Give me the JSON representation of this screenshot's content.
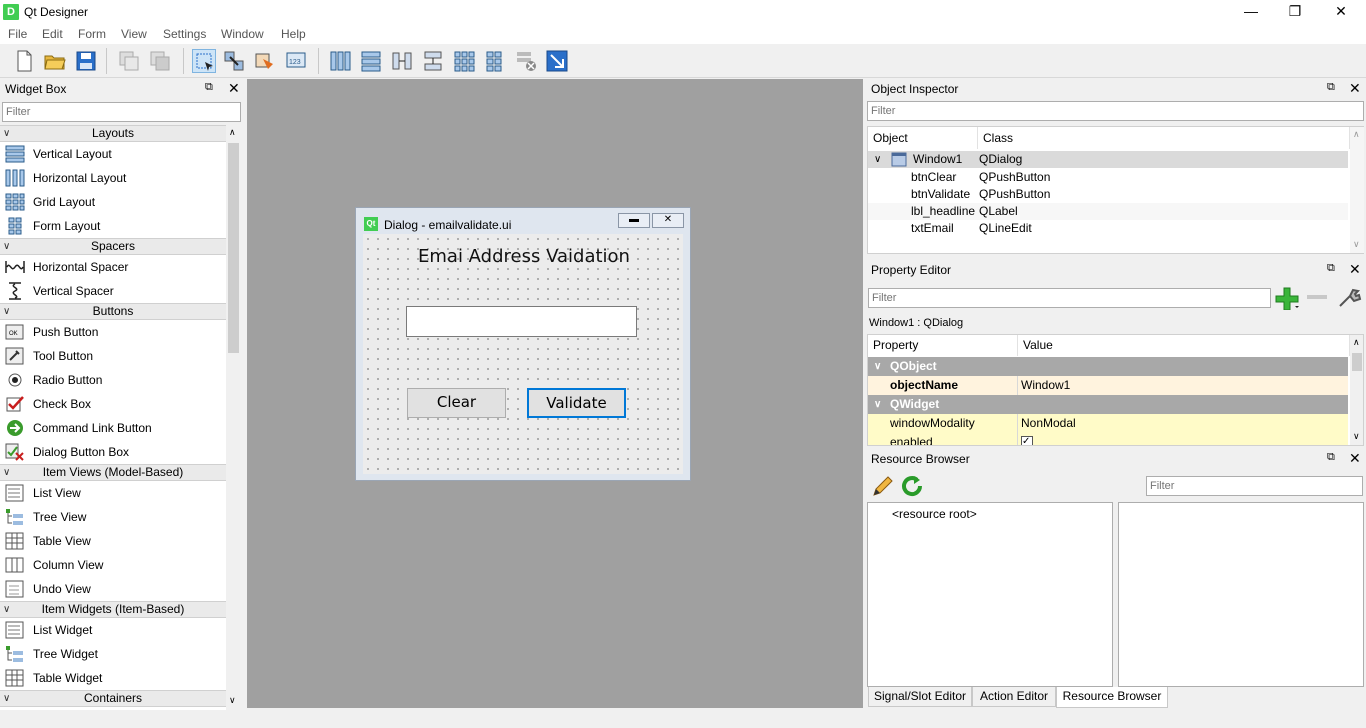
{
  "window": {
    "title": "Qt Designer",
    "icon_letter": "D"
  },
  "menu": [
    "File",
    "Edit",
    "Form",
    "View",
    "Settings",
    "Window",
    "Help"
  ],
  "widget_box": {
    "title": "Widget Box",
    "filter_placeholder": "Filter",
    "categories": [
      {
        "label": "Layouts",
        "items": [
          "Vertical Layout",
          "Horizontal Layout",
          "Grid Layout",
          "Form Layout"
        ]
      },
      {
        "label": "Spacers",
        "items": [
          "Horizontal Spacer",
          "Vertical Spacer"
        ]
      },
      {
        "label": "Buttons",
        "items": [
          "Push Button",
          "Tool Button",
          "Radio Button",
          "Check Box",
          "Command Link Button",
          "Dialog Button Box"
        ]
      },
      {
        "label": "Item Views (Model-Based)",
        "items": [
          "List View",
          "Tree View",
          "Table View",
          "Column View",
          "Undo View"
        ]
      },
      {
        "label": "Item Widgets (Item-Based)",
        "items": [
          "List Widget",
          "Tree Widget",
          "Table Widget"
        ]
      },
      {
        "label": "Containers",
        "items": []
      }
    ]
  },
  "dialog": {
    "title": "Dialog - emailvalidate.ui",
    "qt_badge": "Qt",
    "headline": "Emai Address Vaidation",
    "clear_label": "Clear",
    "validate_label": "Validate"
  },
  "object_inspector": {
    "title": "Object Inspector",
    "filter_placeholder": "Filter",
    "headers": [
      "Object",
      "Class"
    ],
    "root": {
      "object": "Window1",
      "class": "QDialog"
    },
    "children": [
      {
        "object": "btnClear",
        "class": "QPushButton"
      },
      {
        "object": "btnValidate",
        "class": "QPushButton"
      },
      {
        "object": "lbl_headline",
        "class": "QLabel"
      },
      {
        "object": "txtEmail",
        "class": "QLineEdit"
      }
    ]
  },
  "property_editor": {
    "title": "Property Editor",
    "filter_placeholder": "Filter",
    "context": "Window1 : QDialog",
    "headers": [
      "Property",
      "Value"
    ],
    "group1": "QObject",
    "object_name": {
      "property": "objectName",
      "value": "Window1"
    },
    "group2": "QWidget",
    "window_modality": {
      "property": "windowModality",
      "value": "NonModal"
    },
    "enabled": {
      "property": "enabled",
      "value": ""
    }
  },
  "resource_browser": {
    "title": "Resource Browser",
    "filter_placeholder": "Filter",
    "root_label": "<resource root>"
  },
  "bottom_tabs": [
    "Signal/Slot Editor",
    "Action Editor",
    "Resource Browser"
  ],
  "colors": {
    "accent": "#0078d7",
    "qt_green": "#41cd52",
    "group_header": "#a8a8a8",
    "highlight_row": "#fff3de"
  }
}
